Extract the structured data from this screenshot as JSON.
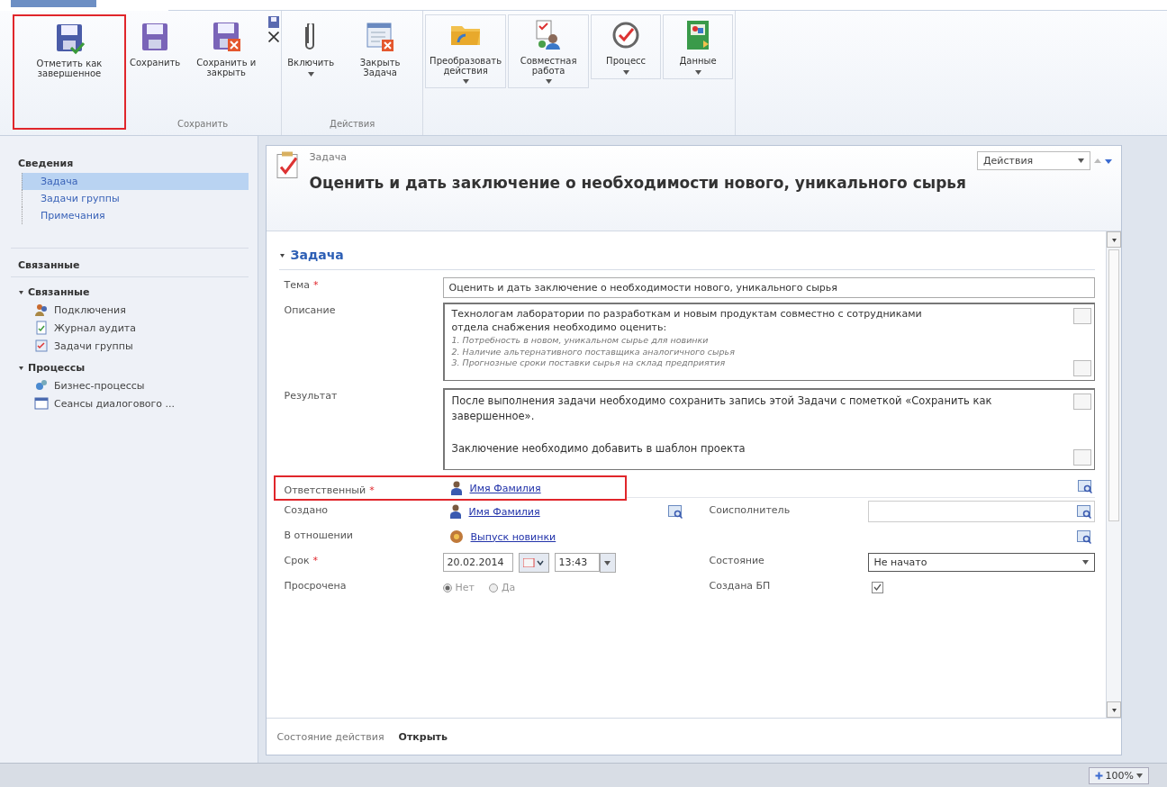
{
  "ribbon": {
    "groups": [
      {
        "label": "Сохранить",
        "buttons": [
          {
            "label": "Отметить как завершенное",
            "menu": false,
            "highlighted": true
          },
          {
            "label": "Сохранить",
            "menu": false,
            "highlighted": false
          },
          {
            "label": "Сохранить и закрыть",
            "menu": false,
            "highlighted": false
          },
          {
            "kind": "small"
          }
        ]
      },
      {
        "label": "Действия",
        "buttons": [
          {
            "label": "Включить",
            "menu": true,
            "highlighted": false
          },
          {
            "label": "Закрыть Задача",
            "menu": false,
            "highlighted": false
          }
        ]
      },
      {
        "buttons": [
          {
            "label": "Преобразовать действия",
            "menu": true,
            "highlighted": false
          },
          {
            "label": "Совместная работа",
            "menu": true,
            "highlighted": false
          },
          {
            "label": "Процесс",
            "menu": true,
            "highlighted": false
          },
          {
            "label": "Данные",
            "menu": true,
            "highlighted": false
          }
        ]
      }
    ]
  },
  "nav": {
    "sections": [
      {
        "title": "Сведения",
        "kind": "tree",
        "items": [
          {
            "label": "Задача",
            "selected": true
          },
          {
            "label": "Задачи группы",
            "selected": false
          },
          {
            "label": "Примечания",
            "selected": false
          }
        ]
      },
      {
        "title": "Связанные",
        "kind": "groups",
        "groups": [
          {
            "label": "Связанные",
            "expanded": true,
            "items": [
              {
                "label": "Подключения"
              },
              {
                "label": "Журнал аудита"
              },
              {
                "label": "Задачи группы"
              }
            ]
          },
          {
            "label": "Процессы",
            "expanded": true,
            "items": [
              {
                "label": "Бизнес-процессы"
              },
              {
                "label": "Сеансы диалогового ..."
              }
            ]
          }
        ]
      }
    ]
  },
  "form": {
    "entity": "Задача",
    "title": "Оценить и дать заключение о необходимости нового, уникального сырья",
    "actions": {
      "label": "Действия"
    },
    "section": {
      "title": "Задача",
      "expanded": true,
      "rows": [
        {
          "left": {
            "kind": "text",
            "label": "Тема",
            "required_mark": "*",
            "value": "Оценить и дать заключение о необходимости нового, уникального сырья"
          }
        },
        {
          "left": {
            "kind": "textarea",
            "label": "Описание",
            "lines": [
              {
                "text": "Технологам лаборатории по разработкам и новым продуктам совместно с сотрудниками",
                "italic": false
              },
              {
                "text": "отдела снабжения необходимо оценить:",
                "italic": false
              },
              {
                "text": "1. Потребность в новом, уникальном сырье для новинки",
                "italic": true
              },
              {
                "text": "2. Наличие альтернативного поставщика аналогичного сырья",
                "italic": true
              },
              {
                "text": "3. Прогнозные сроки поставки сырья на склад предприятия",
                "italic": true
              }
            ]
          }
        },
        {
          "left": {
            "kind": "paragraphs",
            "label": "Результат",
            "paragraphs": [
              "После выполнения задачи необходимо сохранить запись этой Задачи с пометкой «Сохранить как завершенное».",
              "Заключение необходимо добавить в шаблон проекта"
            ]
          }
        },
        {
          "left": {
            "kind": "user_lookup",
            "label": "Ответственный",
            "required_mark": "*",
            "value": "Имя Фамилия",
            "highlighted": true
          }
        },
        {
          "left": {
            "kind": "user_lookup",
            "label": "Создано",
            "value": "Имя Фамилия",
            "highlighted": false
          },
          "right": {
            "kind": "lookup",
            "label": "Соисполнитель",
            "highlighted": false
          }
        },
        {
          "left": {
            "kind": "record_lookup",
            "label": "В отношении",
            "value": "Выпуск новинки",
            "highlighted": false
          }
        },
        {
          "left": {
            "kind": "datetime",
            "label": "Срок",
            "required_mark": "*",
            "date": "20.02.2014",
            "time": "13:43"
          },
          "right": {
            "kind": "select",
            "label": "Состояние",
            "value": "Не начато"
          }
        },
        {
          "left": {
            "kind": "radio",
            "label": "Просрочена",
            "options": [
              {
                "label": "Нет",
                "selected": true
              },
              {
                "label": "Да",
                "selected": false
              }
            ]
          },
          "right": {
            "kind": "checkbox",
            "label": "Создана БП",
            "checked": true
          }
        }
      ]
    }
  },
  "footer": {
    "label": "Состояние действия",
    "value": "Открыть"
  },
  "status_bar": {
    "zoom": "100%"
  }
}
